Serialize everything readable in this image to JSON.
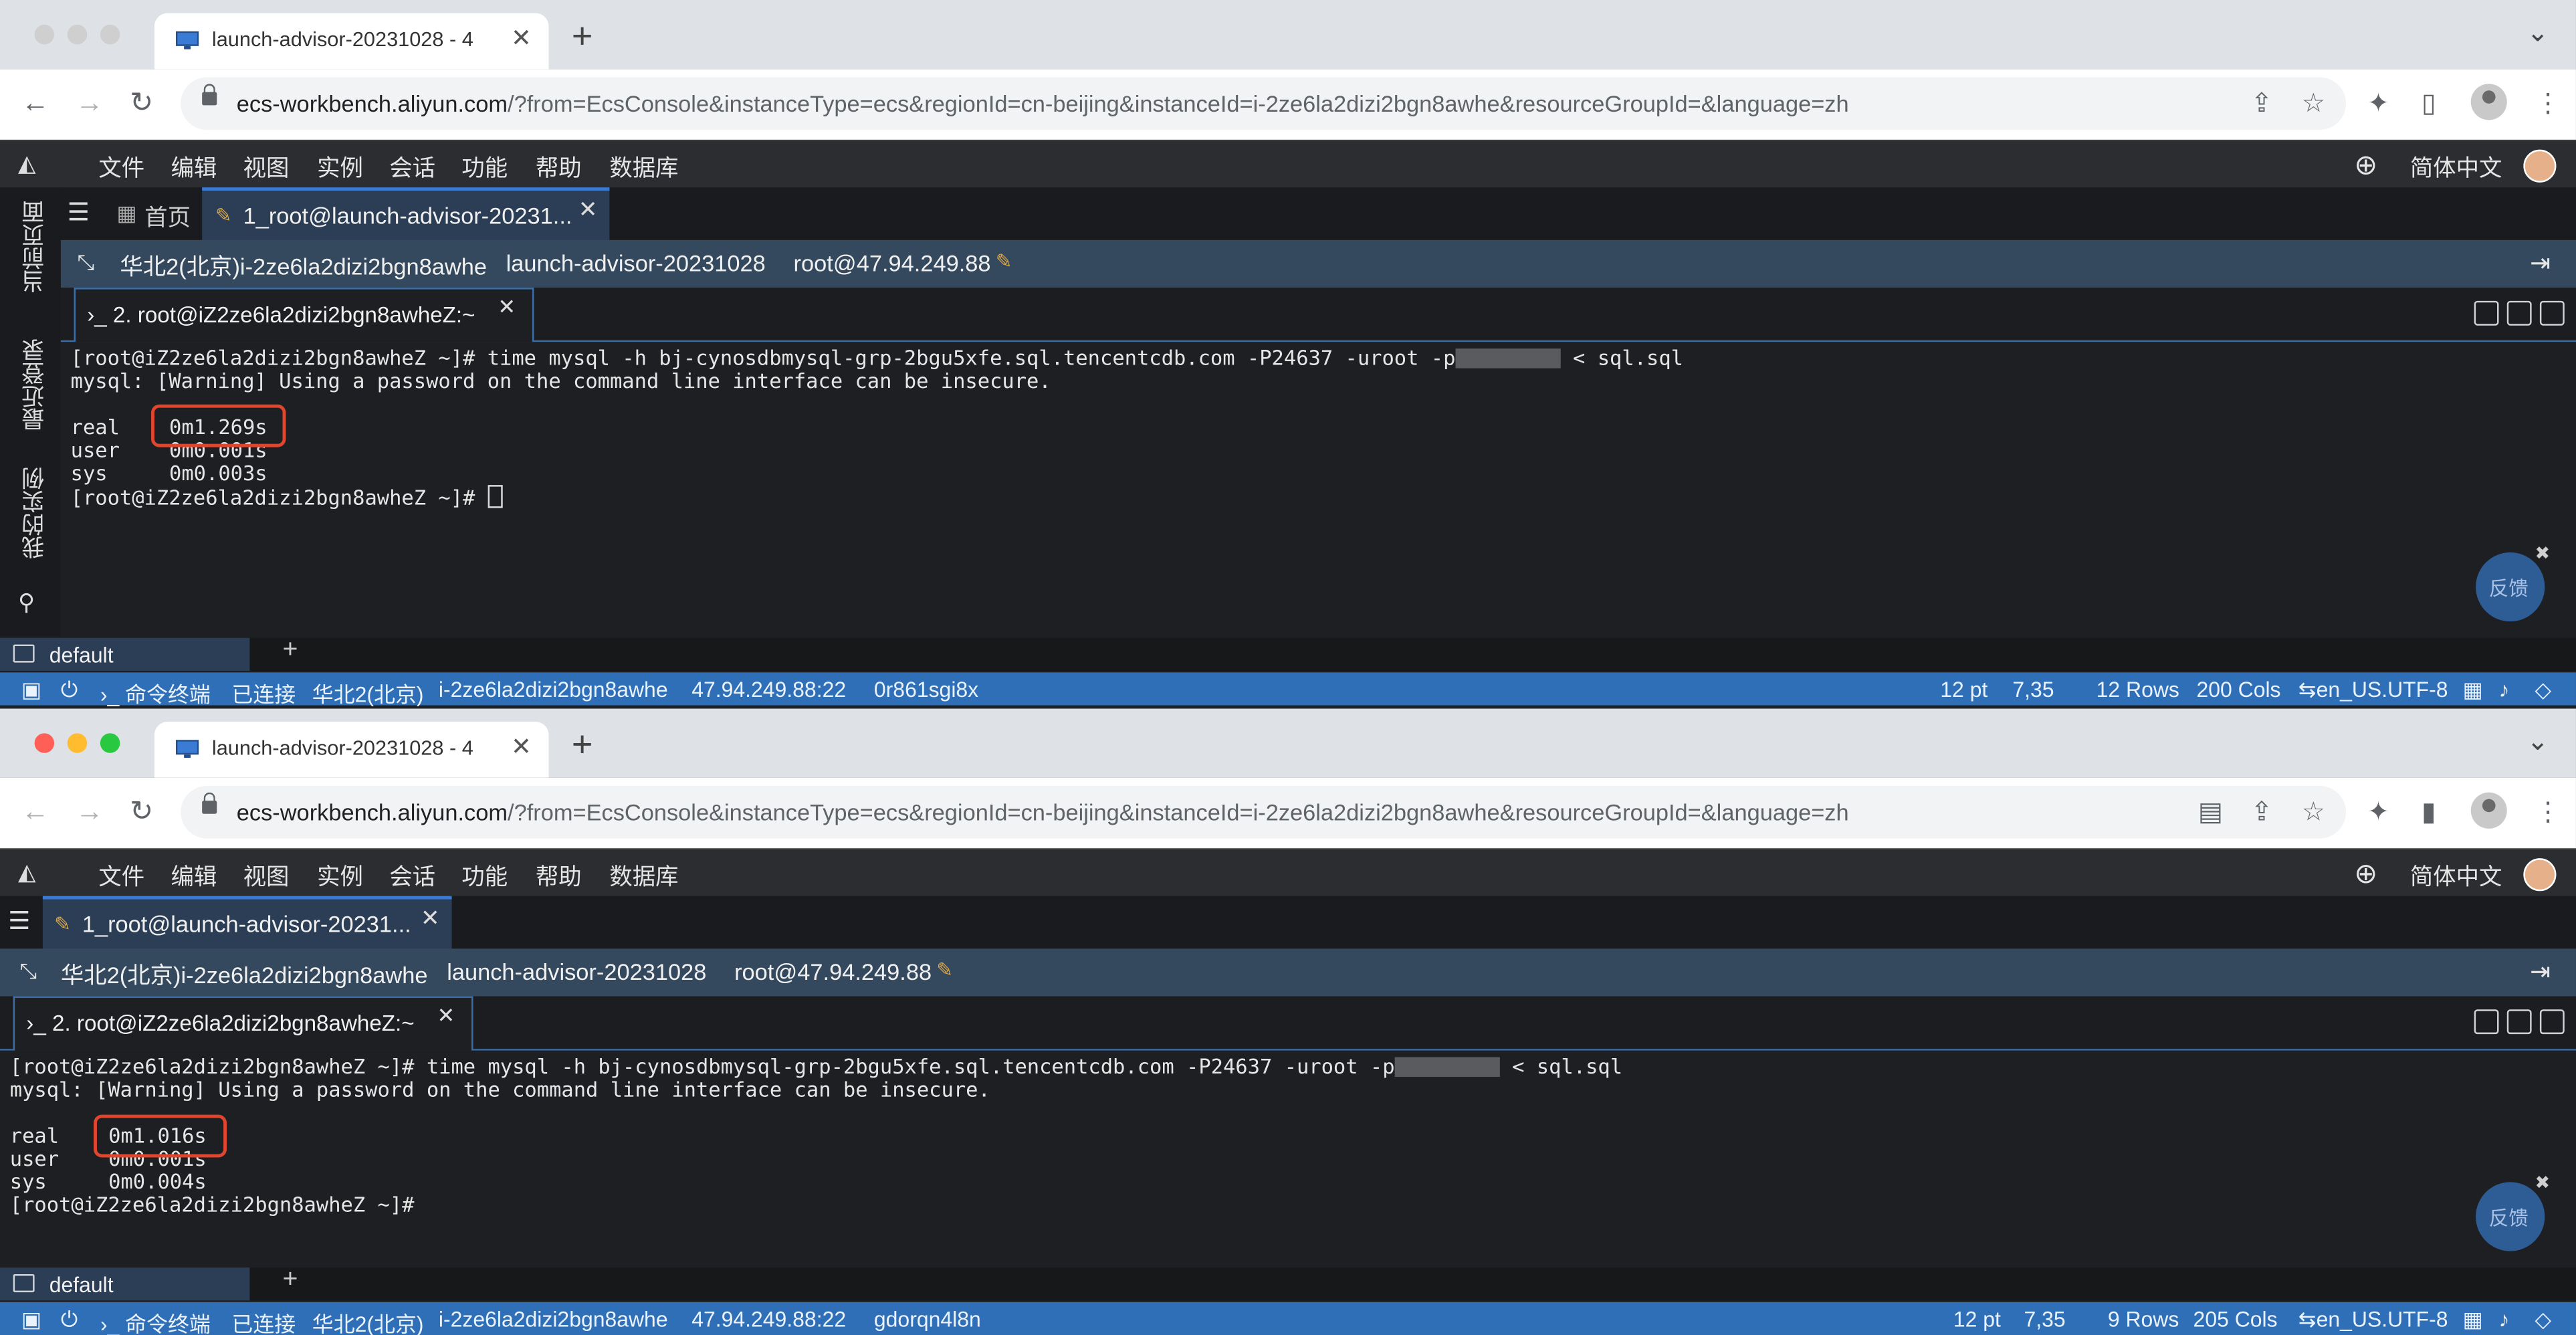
{
  "windows": [
    {
      "tab_title": "launch-advisor-20231028 - 4",
      "address_domain": "ecs-workbench.aliyun.com",
      "address_path": "/?from=EcsConsole&instanceType=ecs&regionId=cn-beijing&instanceId=i-2ze6la2dizi2bgn8awhe&resourceGroupId=&language=zh",
      "menu": [
        "文件",
        "编辑",
        "视图",
        "实例",
        "会话",
        "功能",
        "帮助",
        "数据库"
      ],
      "language": "简体中文",
      "sidebar": [
        "当前页面",
        "最近登录",
        "我的实例"
      ],
      "home_tab": "首页",
      "session_tab": "1_root@launch-advisor-20231...",
      "info": {
        "region": "华北2(北京)i-2ze6la2dizi2bgn8awhe",
        "instance": "launch-advisor-20231028",
        "host": "root@47.94.249.88"
      },
      "term_tab": "2. root@iZ2ze6la2dizi2bgn8awheZ:~",
      "terminal_lines": {
        "cmd_pre": "[root@iZ2ze6la2dizi2bgn8awheZ ~]# time mysql -h bj-cynosdbmysql-grp-2bgu5xfe.sql.tencentcdb.com -P24637 -uroot -p",
        "cmd_post": "< sql.sql",
        "warning": "mysql: [Warning] Using a password on the command line interface can be insecure.",
        "real_label": "real",
        "real_value": "0m1.269s",
        "user_label": "user",
        "user_value": "0m0.001s",
        "sys_label": "sys",
        "sys_value": "0m0.003s",
        "prompt": "[root@iZ2ze6la2dizi2bgn8awheZ ~]#"
      },
      "feedback": "反馈",
      "session_name": "default",
      "status": {
        "terminal": "命令终端",
        "connected": "已连接",
        "region": "华北2(北京)",
        "instance_id": "i-2ze6la2dizi2bgn8awhe",
        "addr": "47.94.249.88:22",
        "session_id": "0r861sgi8x",
        "font": "12 pt",
        "cursor": "7,35",
        "rows": "12 Rows",
        "cols": "200 Cols",
        "locale": "en_US.UTF-8"
      }
    },
    {
      "tab_title": "launch-advisor-20231028 - 4",
      "address_domain": "ecs-workbench.aliyun.com",
      "address_path": "/?from=EcsConsole&instanceType=ecs&regionId=cn-beijing&instanceId=i-2ze6la2dizi2bgn8awhe&resourceGroupId=&language=zh",
      "menu": [
        "文件",
        "编辑",
        "视图",
        "实例",
        "会话",
        "功能",
        "帮助",
        "数据库"
      ],
      "language": "简体中文",
      "session_tab": "1_root@launch-advisor-20231...",
      "info": {
        "region": "华北2(北京)i-2ze6la2dizi2bgn8awhe",
        "instance": "launch-advisor-20231028",
        "host": "root@47.94.249.88"
      },
      "term_tab": "2. root@iZ2ze6la2dizi2bgn8awheZ:~",
      "terminal_lines": {
        "cmd_pre": "[root@iZ2ze6la2dizi2bgn8awheZ ~]# time mysql -h bj-cynosdbmysql-grp-2bgu5xfe.sql.tencentcdb.com -P24637 -uroot -p",
        "cmd_post": "< sql.sql",
        "warning": "mysql: [Warning] Using a password on the command line interface can be insecure.",
        "real_label": "real",
        "real_value": "0m1.016s",
        "user_label": "user",
        "user_value": "0m0.001s",
        "sys_label": "sys",
        "sys_value": "0m0.004s",
        "prompt": "[root@iZ2ze6la2dizi2bgn8awheZ ~]#"
      },
      "feedback": "反馈",
      "session_name": "default",
      "status": {
        "terminal": "命令终端",
        "connected": "已连接",
        "region": "华北2(北京)",
        "instance_id": "i-2ze6la2dizi2bgn8awhe",
        "addr": "47.94.249.88:22",
        "session_id": "gdorqn4l8n",
        "font": "12 pt",
        "cursor": "7,35",
        "rows": "9 Rows",
        "cols": "205 Cols",
        "locale": "en_US.UTF-8"
      }
    }
  ],
  "colors": {
    "highlight_box": "#e0452e",
    "status_bar": "#2f6fb8",
    "info_bar": "#34495e"
  }
}
